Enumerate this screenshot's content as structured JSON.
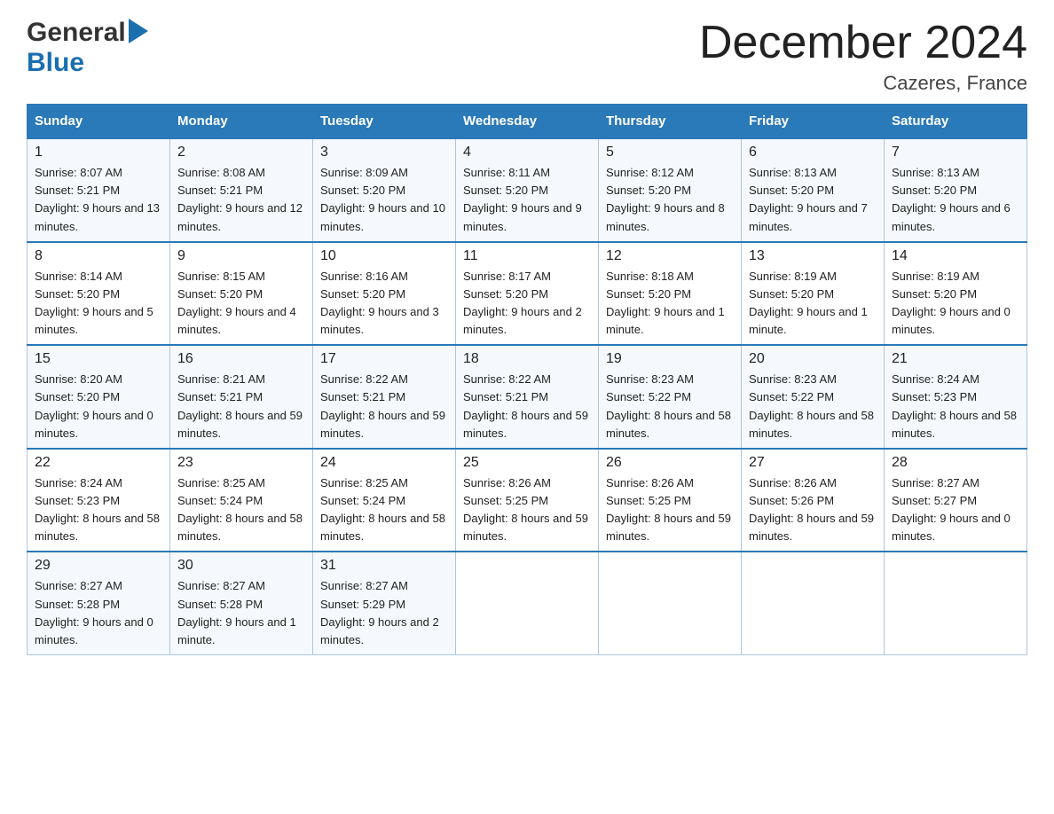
{
  "header": {
    "logo": {
      "general": "General",
      "blue": "Blue",
      "arrow": "▶"
    },
    "title": "December 2024",
    "location": "Cazeres, France"
  },
  "days_header": [
    "Sunday",
    "Monday",
    "Tuesday",
    "Wednesday",
    "Thursday",
    "Friday",
    "Saturday"
  ],
  "weeks": [
    [
      {
        "day": "1",
        "sunrise": "8:07 AM",
        "sunset": "5:21 PM",
        "daylight": "9 hours and 13 minutes."
      },
      {
        "day": "2",
        "sunrise": "8:08 AM",
        "sunset": "5:21 PM",
        "daylight": "9 hours and 12 minutes."
      },
      {
        "day": "3",
        "sunrise": "8:09 AM",
        "sunset": "5:20 PM",
        "daylight": "9 hours and 10 minutes."
      },
      {
        "day": "4",
        "sunrise": "8:11 AM",
        "sunset": "5:20 PM",
        "daylight": "9 hours and 9 minutes."
      },
      {
        "day": "5",
        "sunrise": "8:12 AM",
        "sunset": "5:20 PM",
        "daylight": "9 hours and 8 minutes."
      },
      {
        "day": "6",
        "sunrise": "8:13 AM",
        "sunset": "5:20 PM",
        "daylight": "9 hours and 7 minutes."
      },
      {
        "day": "7",
        "sunrise": "8:13 AM",
        "sunset": "5:20 PM",
        "daylight": "9 hours and 6 minutes."
      }
    ],
    [
      {
        "day": "8",
        "sunrise": "8:14 AM",
        "sunset": "5:20 PM",
        "daylight": "9 hours and 5 minutes."
      },
      {
        "day": "9",
        "sunrise": "8:15 AM",
        "sunset": "5:20 PM",
        "daylight": "9 hours and 4 minutes."
      },
      {
        "day": "10",
        "sunrise": "8:16 AM",
        "sunset": "5:20 PM",
        "daylight": "9 hours and 3 minutes."
      },
      {
        "day": "11",
        "sunrise": "8:17 AM",
        "sunset": "5:20 PM",
        "daylight": "9 hours and 2 minutes."
      },
      {
        "day": "12",
        "sunrise": "8:18 AM",
        "sunset": "5:20 PM",
        "daylight": "9 hours and 1 minute."
      },
      {
        "day": "13",
        "sunrise": "8:19 AM",
        "sunset": "5:20 PM",
        "daylight": "9 hours and 1 minute."
      },
      {
        "day": "14",
        "sunrise": "8:19 AM",
        "sunset": "5:20 PM",
        "daylight": "9 hours and 0 minutes."
      }
    ],
    [
      {
        "day": "15",
        "sunrise": "8:20 AM",
        "sunset": "5:20 PM",
        "daylight": "9 hours and 0 minutes."
      },
      {
        "day": "16",
        "sunrise": "8:21 AM",
        "sunset": "5:21 PM",
        "daylight": "8 hours and 59 minutes."
      },
      {
        "day": "17",
        "sunrise": "8:22 AM",
        "sunset": "5:21 PM",
        "daylight": "8 hours and 59 minutes."
      },
      {
        "day": "18",
        "sunrise": "8:22 AM",
        "sunset": "5:21 PM",
        "daylight": "8 hours and 59 minutes."
      },
      {
        "day": "19",
        "sunrise": "8:23 AM",
        "sunset": "5:22 PM",
        "daylight": "8 hours and 58 minutes."
      },
      {
        "day": "20",
        "sunrise": "8:23 AM",
        "sunset": "5:22 PM",
        "daylight": "8 hours and 58 minutes."
      },
      {
        "day": "21",
        "sunrise": "8:24 AM",
        "sunset": "5:23 PM",
        "daylight": "8 hours and 58 minutes."
      }
    ],
    [
      {
        "day": "22",
        "sunrise": "8:24 AM",
        "sunset": "5:23 PM",
        "daylight": "8 hours and 58 minutes."
      },
      {
        "day": "23",
        "sunrise": "8:25 AM",
        "sunset": "5:24 PM",
        "daylight": "8 hours and 58 minutes."
      },
      {
        "day": "24",
        "sunrise": "8:25 AM",
        "sunset": "5:24 PM",
        "daylight": "8 hours and 58 minutes."
      },
      {
        "day": "25",
        "sunrise": "8:26 AM",
        "sunset": "5:25 PM",
        "daylight": "8 hours and 59 minutes."
      },
      {
        "day": "26",
        "sunrise": "8:26 AM",
        "sunset": "5:25 PM",
        "daylight": "8 hours and 59 minutes."
      },
      {
        "day": "27",
        "sunrise": "8:26 AM",
        "sunset": "5:26 PM",
        "daylight": "8 hours and 59 minutes."
      },
      {
        "day": "28",
        "sunrise": "8:27 AM",
        "sunset": "5:27 PM",
        "daylight": "9 hours and 0 minutes."
      }
    ],
    [
      {
        "day": "29",
        "sunrise": "8:27 AM",
        "sunset": "5:28 PM",
        "daylight": "9 hours and 0 minutes."
      },
      {
        "day": "30",
        "sunrise": "8:27 AM",
        "sunset": "5:28 PM",
        "daylight": "9 hours and 1 minute."
      },
      {
        "day": "31",
        "sunrise": "8:27 AM",
        "sunset": "5:29 PM",
        "daylight": "9 hours and 2 minutes."
      },
      null,
      null,
      null,
      null
    ]
  ],
  "labels": {
    "sunrise": "Sunrise: ",
    "sunset": "Sunset: ",
    "daylight": "Daylight: "
  }
}
